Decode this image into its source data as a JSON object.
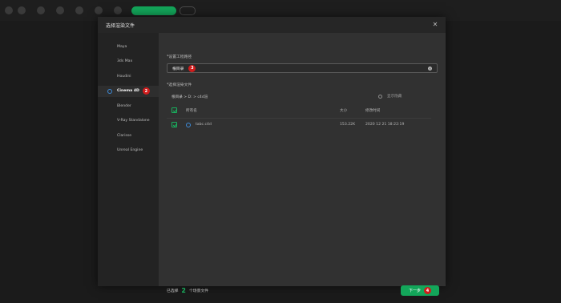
{
  "dialog": {
    "title": "选择渲染文件",
    "close_glyph": "✕"
  },
  "sidebar": {
    "items": [
      {
        "label": "Maya"
      },
      {
        "label": "3ds Max"
      },
      {
        "label": "Houdini"
      },
      {
        "label": "Cinema 4D",
        "badge": "2"
      },
      {
        "label": "Blender"
      },
      {
        "label": "V-Ray Standalone"
      },
      {
        "label": "Clarisse"
      },
      {
        "label": "Unreal Engine"
      }
    ]
  },
  "project_path": {
    "label": "*设置工程路径",
    "value": "根目录",
    "badge": "3"
  },
  "render_file": {
    "label": "*选择渲染文件",
    "breadcrumb": "根目录 > D: > c4d渲",
    "show_hidden_label": "显示隐藏"
  },
  "table": {
    "columns": {
      "name": "所有名",
      "size": "大小",
      "modified": "修改时间"
    },
    "rows": [
      {
        "name": "tabc.c4d",
        "size": "153.22K",
        "modified": "2020 12 21 18:22:19",
        "checked": true
      }
    ]
  },
  "footer": {
    "selected_prefix": "已选择",
    "selected_count": "2",
    "selected_suffix": "个场景文件",
    "next_label": "下一步",
    "next_badge": "4"
  },
  "colors": {
    "accent_green": "#13a65a",
    "badge_red": "#d11c1c",
    "c4d_blue": "#3d8bd9"
  }
}
